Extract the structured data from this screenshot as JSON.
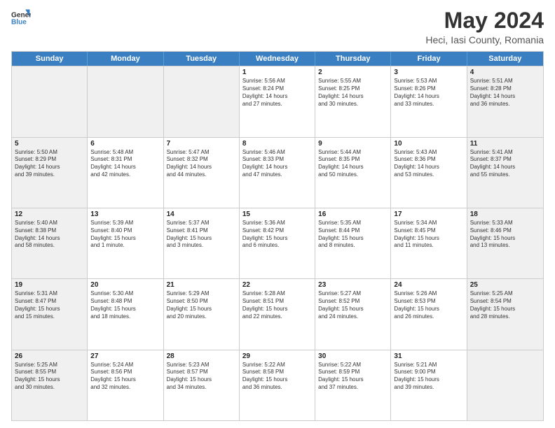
{
  "logo": {
    "line1": "General",
    "line2": "Blue"
  },
  "title": "May 2024",
  "subtitle": "Heci, Iasi County, Romania",
  "header_days": [
    "Sunday",
    "Monday",
    "Tuesday",
    "Wednesday",
    "Thursday",
    "Friday",
    "Saturday"
  ],
  "weeks": [
    [
      {
        "day": "",
        "info": [],
        "shaded": true
      },
      {
        "day": "",
        "info": [],
        "shaded": true
      },
      {
        "day": "",
        "info": [],
        "shaded": true
      },
      {
        "day": "1",
        "info": [
          "Sunrise: 5:56 AM",
          "Sunset: 8:24 PM",
          "Daylight: 14 hours",
          "and 27 minutes."
        ],
        "shaded": false
      },
      {
        "day": "2",
        "info": [
          "Sunrise: 5:55 AM",
          "Sunset: 8:25 PM",
          "Daylight: 14 hours",
          "and 30 minutes."
        ],
        "shaded": false
      },
      {
        "day": "3",
        "info": [
          "Sunrise: 5:53 AM",
          "Sunset: 8:26 PM",
          "Daylight: 14 hours",
          "and 33 minutes."
        ],
        "shaded": false
      },
      {
        "day": "4",
        "info": [
          "Sunrise: 5:51 AM",
          "Sunset: 8:28 PM",
          "Daylight: 14 hours",
          "and 36 minutes."
        ],
        "shaded": true
      }
    ],
    [
      {
        "day": "5",
        "info": [
          "Sunrise: 5:50 AM",
          "Sunset: 8:29 PM",
          "Daylight: 14 hours",
          "and 39 minutes."
        ],
        "shaded": true
      },
      {
        "day": "6",
        "info": [
          "Sunrise: 5:48 AM",
          "Sunset: 8:31 PM",
          "Daylight: 14 hours",
          "and 42 minutes."
        ],
        "shaded": false
      },
      {
        "day": "7",
        "info": [
          "Sunrise: 5:47 AM",
          "Sunset: 8:32 PM",
          "Daylight: 14 hours",
          "and 44 minutes."
        ],
        "shaded": false
      },
      {
        "day": "8",
        "info": [
          "Sunrise: 5:46 AM",
          "Sunset: 8:33 PM",
          "Daylight: 14 hours",
          "and 47 minutes."
        ],
        "shaded": false
      },
      {
        "day": "9",
        "info": [
          "Sunrise: 5:44 AM",
          "Sunset: 8:35 PM",
          "Daylight: 14 hours",
          "and 50 minutes."
        ],
        "shaded": false
      },
      {
        "day": "10",
        "info": [
          "Sunrise: 5:43 AM",
          "Sunset: 8:36 PM",
          "Daylight: 14 hours",
          "and 53 minutes."
        ],
        "shaded": false
      },
      {
        "day": "11",
        "info": [
          "Sunrise: 5:41 AM",
          "Sunset: 8:37 PM",
          "Daylight: 14 hours",
          "and 55 minutes."
        ],
        "shaded": true
      }
    ],
    [
      {
        "day": "12",
        "info": [
          "Sunrise: 5:40 AM",
          "Sunset: 8:38 PM",
          "Daylight: 14 hours",
          "and 58 minutes."
        ],
        "shaded": true
      },
      {
        "day": "13",
        "info": [
          "Sunrise: 5:39 AM",
          "Sunset: 8:40 PM",
          "Daylight: 15 hours",
          "and 1 minute."
        ],
        "shaded": false
      },
      {
        "day": "14",
        "info": [
          "Sunrise: 5:37 AM",
          "Sunset: 8:41 PM",
          "Daylight: 15 hours",
          "and 3 minutes."
        ],
        "shaded": false
      },
      {
        "day": "15",
        "info": [
          "Sunrise: 5:36 AM",
          "Sunset: 8:42 PM",
          "Daylight: 15 hours",
          "and 6 minutes."
        ],
        "shaded": false
      },
      {
        "day": "16",
        "info": [
          "Sunrise: 5:35 AM",
          "Sunset: 8:44 PM",
          "Daylight: 15 hours",
          "and 8 minutes."
        ],
        "shaded": false
      },
      {
        "day": "17",
        "info": [
          "Sunrise: 5:34 AM",
          "Sunset: 8:45 PM",
          "Daylight: 15 hours",
          "and 11 minutes."
        ],
        "shaded": false
      },
      {
        "day": "18",
        "info": [
          "Sunrise: 5:33 AM",
          "Sunset: 8:46 PM",
          "Daylight: 15 hours",
          "and 13 minutes."
        ],
        "shaded": true
      }
    ],
    [
      {
        "day": "19",
        "info": [
          "Sunrise: 5:31 AM",
          "Sunset: 8:47 PM",
          "Daylight: 15 hours",
          "and 15 minutes."
        ],
        "shaded": true
      },
      {
        "day": "20",
        "info": [
          "Sunrise: 5:30 AM",
          "Sunset: 8:48 PM",
          "Daylight: 15 hours",
          "and 18 minutes."
        ],
        "shaded": false
      },
      {
        "day": "21",
        "info": [
          "Sunrise: 5:29 AM",
          "Sunset: 8:50 PM",
          "Daylight: 15 hours",
          "and 20 minutes."
        ],
        "shaded": false
      },
      {
        "day": "22",
        "info": [
          "Sunrise: 5:28 AM",
          "Sunset: 8:51 PM",
          "Daylight: 15 hours",
          "and 22 minutes."
        ],
        "shaded": false
      },
      {
        "day": "23",
        "info": [
          "Sunrise: 5:27 AM",
          "Sunset: 8:52 PM",
          "Daylight: 15 hours",
          "and 24 minutes."
        ],
        "shaded": false
      },
      {
        "day": "24",
        "info": [
          "Sunrise: 5:26 AM",
          "Sunset: 8:53 PM",
          "Daylight: 15 hours",
          "and 26 minutes."
        ],
        "shaded": false
      },
      {
        "day": "25",
        "info": [
          "Sunrise: 5:25 AM",
          "Sunset: 8:54 PM",
          "Daylight: 15 hours",
          "and 28 minutes."
        ],
        "shaded": true
      }
    ],
    [
      {
        "day": "26",
        "info": [
          "Sunrise: 5:25 AM",
          "Sunset: 8:55 PM",
          "Daylight: 15 hours",
          "and 30 minutes."
        ],
        "shaded": true
      },
      {
        "day": "27",
        "info": [
          "Sunrise: 5:24 AM",
          "Sunset: 8:56 PM",
          "Daylight: 15 hours",
          "and 32 minutes."
        ],
        "shaded": false
      },
      {
        "day": "28",
        "info": [
          "Sunrise: 5:23 AM",
          "Sunset: 8:57 PM",
          "Daylight: 15 hours",
          "and 34 minutes."
        ],
        "shaded": false
      },
      {
        "day": "29",
        "info": [
          "Sunrise: 5:22 AM",
          "Sunset: 8:58 PM",
          "Daylight: 15 hours",
          "and 36 minutes."
        ],
        "shaded": false
      },
      {
        "day": "30",
        "info": [
          "Sunrise: 5:22 AM",
          "Sunset: 8:59 PM",
          "Daylight: 15 hours",
          "and 37 minutes."
        ],
        "shaded": false
      },
      {
        "day": "31",
        "info": [
          "Sunrise: 5:21 AM",
          "Sunset: 9:00 PM",
          "Daylight: 15 hours",
          "and 39 minutes."
        ],
        "shaded": false
      },
      {
        "day": "",
        "info": [],
        "shaded": true
      }
    ]
  ]
}
